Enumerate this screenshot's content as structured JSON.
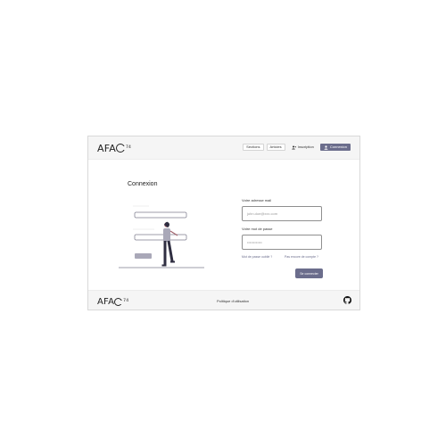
{
  "header": {
    "logo_text": "AFA",
    "logo_number": "74",
    "nav": {
      "sections": "Sections",
      "articles": "Articles",
      "signup": "Inscription",
      "login": "Connexion"
    }
  },
  "main": {
    "title": "Connexion",
    "email": {
      "label": "Votre adresse mail",
      "placeholder": "john.doe@xxx.com"
    },
    "password": {
      "label": "Votre mot de passe",
      "placeholder": "••••••••••••"
    },
    "forgot_link": "Mot de passe oublié ?",
    "no_account_link": "Pas encore de compte ?",
    "submit": "Se connecter"
  },
  "footer": {
    "logo_text": "AFA",
    "logo_number": "74",
    "policy": "Politique d'utilisation"
  },
  "colors": {
    "accent": "#6b6d8c",
    "header_bg": "#f5f5f5"
  }
}
